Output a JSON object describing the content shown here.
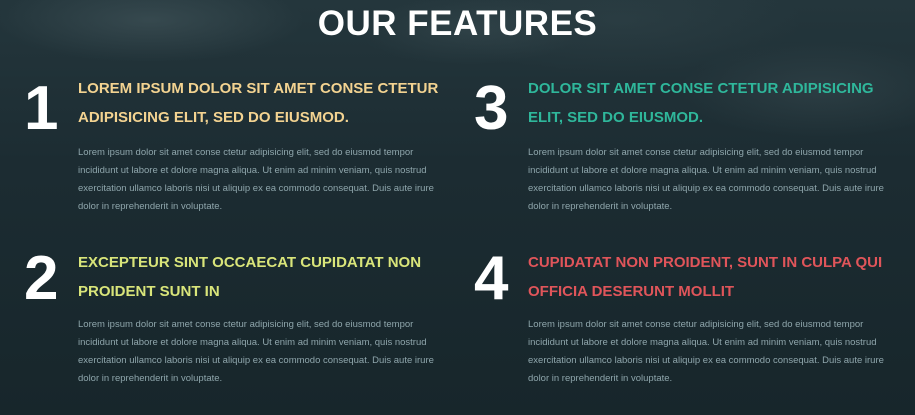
{
  "section": {
    "title": "OUR FEATURES"
  },
  "features": [
    {
      "number": "1",
      "heading": "LOREM IPSUM DOLOR SIT AMET CONSE CTETUR ADIPISICING ELIT, SED DO EIUSMOD.",
      "color": "#f3d391",
      "description": "Lorem ipsum dolor sit amet conse ctetur adipisicing elit, sed do eiusmod tempor incididunt ut labore et dolore magna aliqua. Ut enim ad minim veniam, quis nostrud exercitation ullamco laboris nisi ut aliquip ex ea commodo consequat. Duis aute irure dolor in reprehenderit in voluptate."
    },
    {
      "number": "2",
      "heading": "EXCEPTEUR SINT OCCAECAT CUPIDATAT NON PROIDENT SUNT IN",
      "color": "#d9e57a",
      "description": "Lorem ipsum dolor sit amet conse ctetur adipisicing elit, sed do eiusmod tempor incididunt ut labore et dolore magna aliqua. Ut enim ad minim veniam, quis nostrud exercitation ullamco laboris nisi ut aliquip ex ea commodo consequat. Duis aute irure dolor in reprehenderit in voluptate."
    },
    {
      "number": "3",
      "heading": "DOLOR SIT AMET CONSE CTETUR ADIPISICING ELIT, SED DO EIUSMOD.",
      "color": "#2fb79b",
      "description": "Lorem ipsum dolor sit amet conse ctetur adipisicing elit, sed do eiusmod tempor incididunt ut labore et dolore magna aliqua. Ut enim ad minim veniam, quis nostrud exercitation ullamco laboris nisi ut aliquip ex ea commodo consequat. Duis aute irure dolor in reprehenderit in voluptate."
    },
    {
      "number": "4",
      "heading": "CUPIDATAT NON PROIDENT, SUNT IN CULPA QUI OFFICIA DESERUNT MOLLIT",
      "color": "#e0555a",
      "description": "Lorem ipsum dolor sit amet conse ctetur adipisicing elit, sed do eiusmod tempor incididunt ut labore et dolore magna aliqua. Ut enim ad minim veniam, quis nostrud exercitation ullamco laboris nisi ut aliquip ex ea commodo consequat. Duis aute irure dolor in reprehenderit in voluptate."
    }
  ]
}
